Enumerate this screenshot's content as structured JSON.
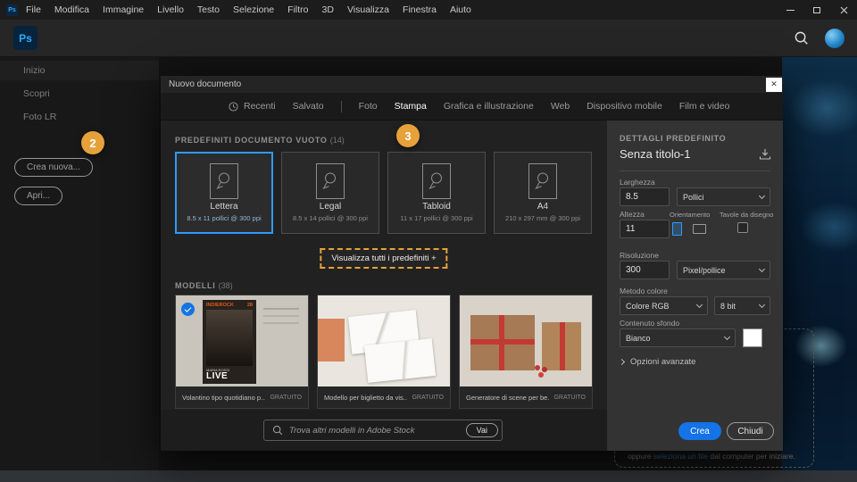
{
  "colors": {
    "accent": "#1473e6",
    "coach": "#e7a13b",
    "link": "#4a9fdf",
    "selection": "#2f9bff"
  },
  "titlebar": {
    "menus": [
      "File",
      "Modifica",
      "Immagine",
      "Livello",
      "Testo",
      "Selezione",
      "Filtro",
      "3D",
      "Visualizza",
      "Finestra",
      "Aiuto"
    ]
  },
  "sidebar": {
    "items": [
      "Inizio",
      "Scopri",
      "Foto LR"
    ],
    "create_button": "Crea nuova...",
    "open_button": "Apri..."
  },
  "coach": {
    "step2": "2",
    "step3": "3"
  },
  "dialog": {
    "title": "Nuovo documento",
    "close": "✕",
    "tabs": [
      "Recenti",
      "Salvato",
      "Foto",
      "Stampa",
      "Grafica e illustrazione",
      "Web",
      "Dispositivo mobile",
      "Film e video"
    ],
    "presets": {
      "heading": "PREDEFINITI DOCUMENTO VUOTO",
      "count": "(14)",
      "items": [
        {
          "name": "Lettera",
          "specs": "8.5 x 11 pollici @ 300 ppi"
        },
        {
          "name": "Legal",
          "specs": "8.5 x 14 pollici @ 300 ppi"
        },
        {
          "name": "Tabloid",
          "specs": "11 x 17 pollici @ 300 ppi"
        },
        {
          "name": "A4",
          "specs": "210 x 297 mm @ 300 ppi"
        }
      ],
      "view_all": "Visualizza tutti i predefiniti +"
    },
    "templates": {
      "heading": "MODELLI",
      "count": "(38)",
      "items": [
        {
          "name": "Volantino tipo quotidiano p...",
          "price": "GRATUITO"
        },
        {
          "name": "Modello per biglietto da vis...",
          "price": "GRATUITO"
        },
        {
          "name": "Generatore di scene per be...",
          "price": "GRATUITO"
        }
      ],
      "poster": {
        "brand": "INDIEROCK",
        "issue": "28",
        "artist": "MARIA ROSSI",
        "live": "LIVE"
      },
      "search_placeholder": "Trova altri modelli in Adobe Stock",
      "search_button": "Vai"
    },
    "details": {
      "heading": "DETTAGLI PREDEFINITO",
      "doc_name": "Senza titolo-1",
      "width_label": "Larghezza",
      "width_value": "8.5",
      "width_unit": "Pollici",
      "height_label": "Altezza",
      "height_value": "11",
      "orientation_label": "Orientamento",
      "artboards_label": "Tavole da disegno",
      "resolution_label": "Risoluzione",
      "resolution_value": "300",
      "resolution_unit": "Pixel/pollice",
      "color_mode_label": "Metodo colore",
      "color_mode_value": "Colore RGB",
      "bit_depth_value": "8 bit",
      "background_label": "Contenuto sfondo",
      "background_value": "Bianco",
      "advanced_label": "Opzioni avanzate",
      "create_button": "Crea",
      "close_button": "Chiudi"
    }
  },
  "background_hint": {
    "prefix": "oppure",
    "link": "seleziona un file",
    "suffix": "dal computer per iniziare."
  }
}
